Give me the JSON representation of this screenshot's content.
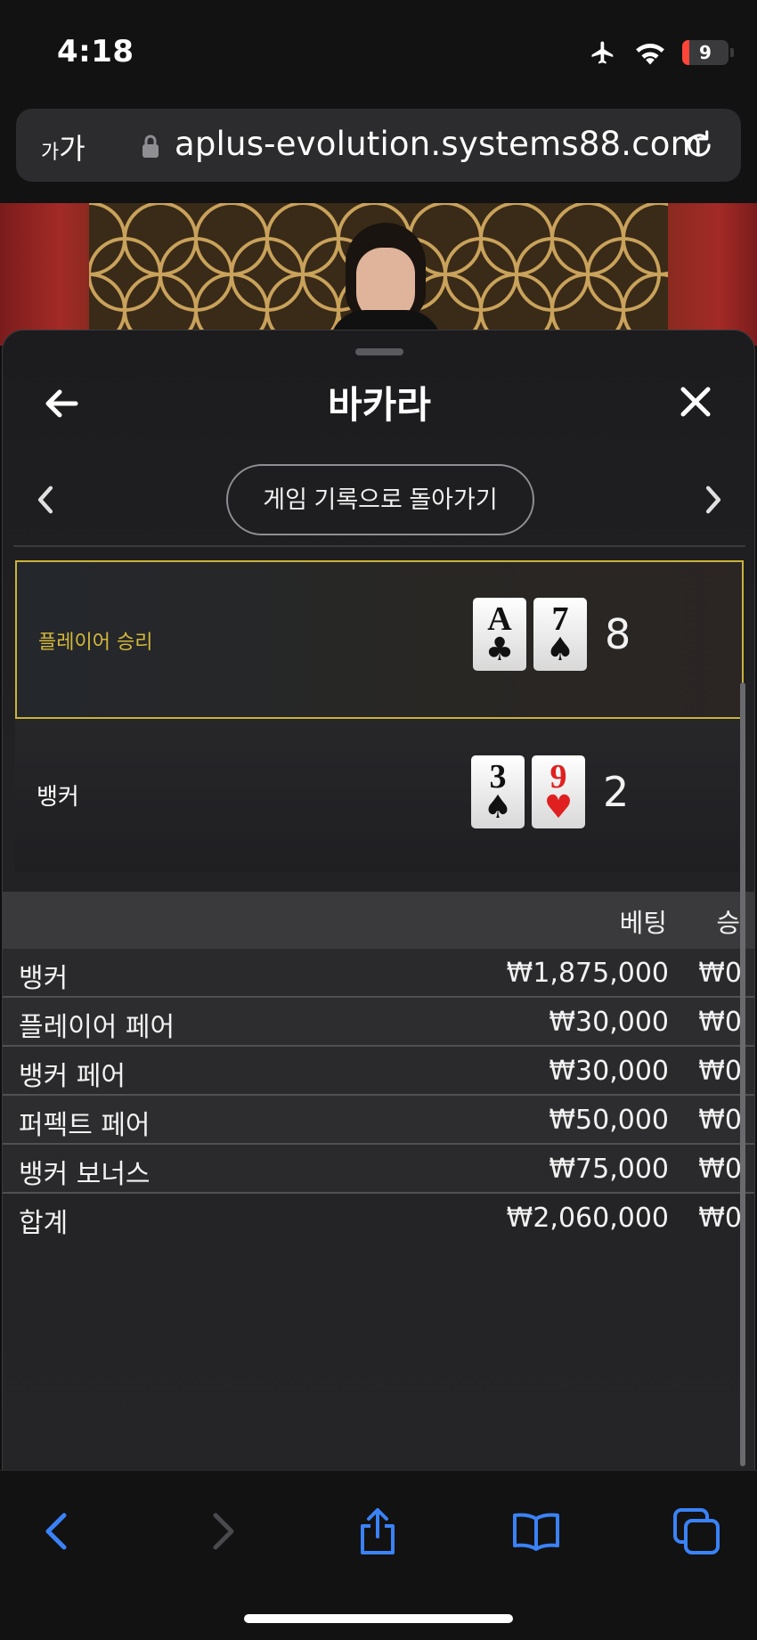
{
  "status": {
    "time": "4:18",
    "battery": "9"
  },
  "browser": {
    "text_size_small": "가",
    "text_size_large": "가",
    "url": "aplus-evolution.systems88.com"
  },
  "panel": {
    "title": "바카라",
    "back_to_history_label": "게임 기록으로 돌아가기"
  },
  "result": {
    "player": {
      "label": "플레이어 승리",
      "cards": [
        {
          "rank": "A",
          "suit": "♣",
          "color": "black"
        },
        {
          "rank": "7",
          "suit": "♠",
          "color": "black"
        }
      ],
      "score": "8"
    },
    "banker": {
      "label": "뱅커",
      "cards": [
        {
          "rank": "3",
          "suit": "♠",
          "color": "black"
        },
        {
          "rank": "9",
          "suit": "♥",
          "color": "red"
        }
      ],
      "score": "2"
    }
  },
  "bets": {
    "header": {
      "bet": "베팅",
      "win": "승"
    },
    "rows": [
      {
        "name": "뱅커",
        "amount": "₩1,875,000",
        "win": "₩0"
      },
      {
        "name": "플레이어 페어",
        "amount": "₩30,000",
        "win": "₩0"
      },
      {
        "name": "뱅커 페어",
        "amount": "₩30,000",
        "win": "₩0"
      },
      {
        "name": "퍼펙트 페어",
        "amount": "₩50,000",
        "win": "₩0"
      },
      {
        "name": "뱅커 보너스",
        "amount": "₩75,000",
        "win": "₩0"
      }
    ],
    "total": {
      "name": "합계",
      "amount": "₩2,060,000",
      "win": "₩0"
    }
  },
  "colors": {
    "accent_blue": "#3a82f7",
    "winner_gold": "#d4b93a",
    "red_suit": "#e02020"
  },
  "icons": [
    "airplane-icon",
    "wifi-icon",
    "battery-icon",
    "lock-icon",
    "reload-icon",
    "back-arrow-icon",
    "close-icon",
    "chevron-left-icon",
    "chevron-right-icon",
    "share-icon",
    "bookmarks-icon",
    "tabs-icon"
  ]
}
